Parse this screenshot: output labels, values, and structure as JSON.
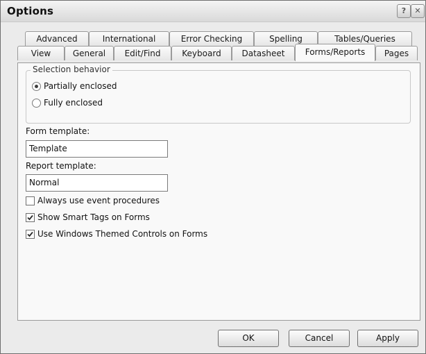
{
  "window": {
    "title": "Options"
  },
  "titlebar_buttons": {
    "help": "?",
    "close": "✕"
  },
  "tabs_back": [
    {
      "label": "Advanced"
    },
    {
      "label": "International"
    },
    {
      "label": "Error Checking"
    },
    {
      "label": "Spelling"
    },
    {
      "label": "Tables/Queries"
    }
  ],
  "tabs_front": [
    {
      "label": "View"
    },
    {
      "label": "General"
    },
    {
      "label": "Edit/Find"
    },
    {
      "label": "Keyboard"
    },
    {
      "label": "Datasheet"
    },
    {
      "label": "Forms/Reports",
      "selected": true
    },
    {
      "label": "Pages"
    }
  ],
  "selection_behavior": {
    "label": "Selection behavior",
    "options": [
      {
        "label": "Partially enclosed",
        "selected": true
      },
      {
        "label": "Fully enclosed",
        "selected": false
      }
    ]
  },
  "form_template": {
    "label": "Form template:",
    "value": "Template"
  },
  "report_template": {
    "label": "Report template:",
    "value": "Normal"
  },
  "checkboxes": [
    {
      "label": "Always use event procedures",
      "checked": false
    },
    {
      "label": "Show Smart Tags on Forms",
      "checked": true
    },
    {
      "label": "Use Windows Themed Controls on Forms",
      "checked": true
    }
  ],
  "buttons": {
    "ok": "OK",
    "cancel": "Cancel",
    "apply": "Apply"
  }
}
